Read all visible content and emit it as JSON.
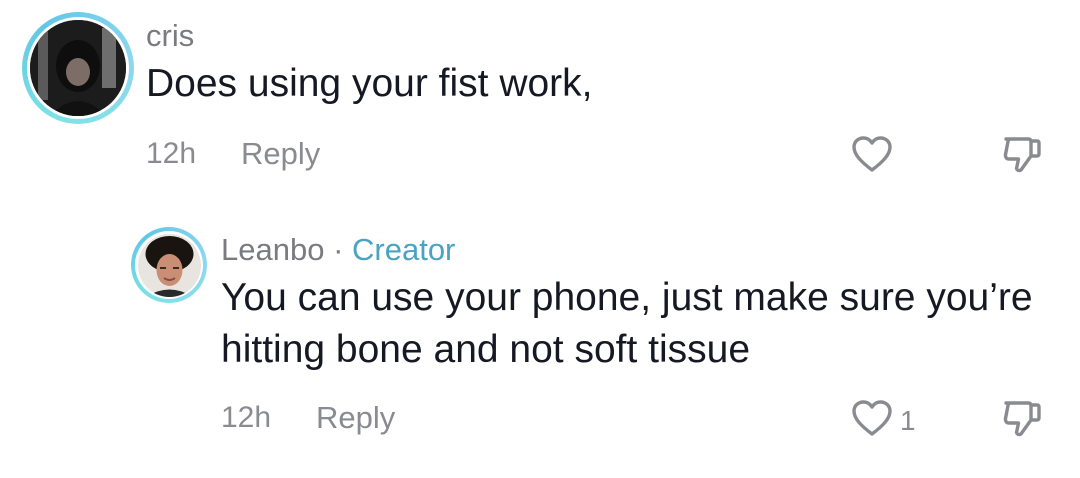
{
  "comments": [
    {
      "username": "cris",
      "text": "Does using your fist work,",
      "time": "12h",
      "reply_label": "Reply",
      "likes": ""
    },
    {
      "username": "Leanbo",
      "separator": " · ",
      "badge": "Creator",
      "text": "You can use your phone, just make sure you’re hitting bone and not soft tissue",
      "time": "12h",
      "reply_label": "Reply",
      "likes": "1"
    }
  ],
  "icons": {
    "like": "heart-outline-icon",
    "dislike": "thumbs-down-outline-icon"
  }
}
